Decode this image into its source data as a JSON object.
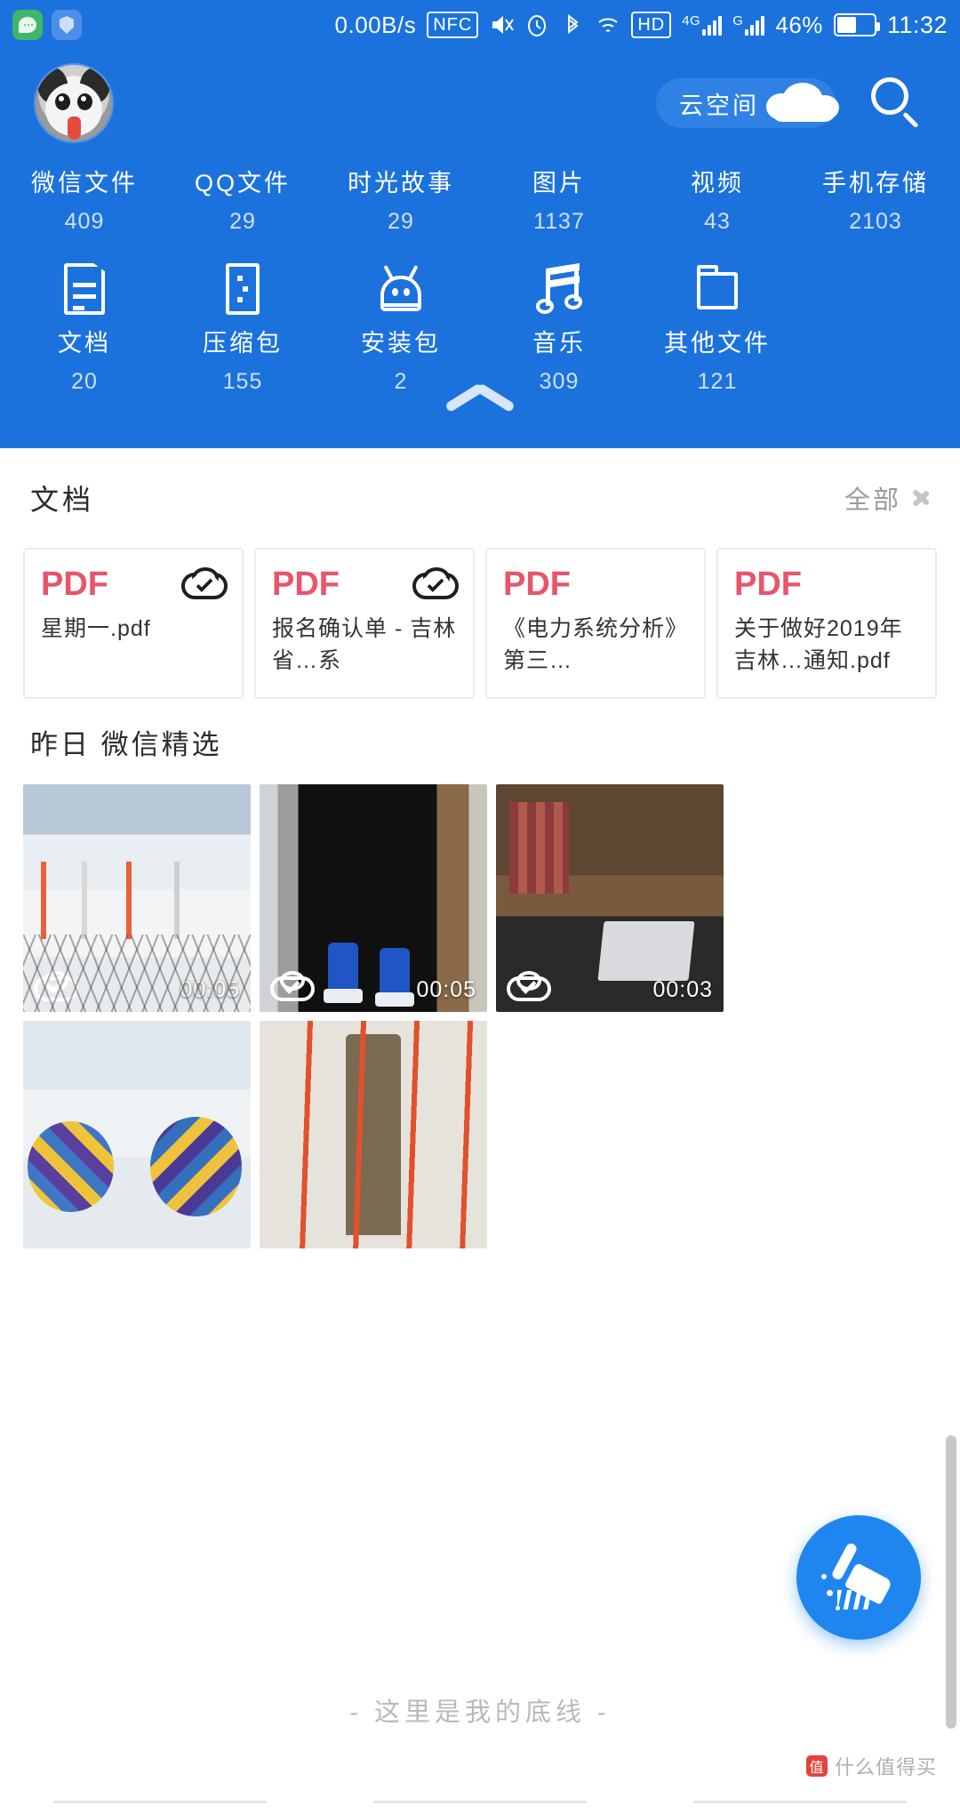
{
  "status_bar": {
    "network_speed": "0.00B/s",
    "nfc_label": "NFC",
    "hd_label": "HD",
    "sim1_label": "4G",
    "sim2_label": "G",
    "battery_percent": "46%",
    "time": "11:32",
    "icons": [
      "chat-app-icon",
      "shield-app-icon",
      "mute-icon",
      "alarm-icon",
      "bluetooth-icon",
      "wifi-icon"
    ]
  },
  "header": {
    "avatar_name": "user-avatar",
    "cloud_button_label": "云空间",
    "search_label": "search-icon",
    "collapse_label": "collapse-header",
    "categories_row1": [
      {
        "label": "微信文件",
        "count": "409"
      },
      {
        "label": "QQ文件",
        "count": "29"
      },
      {
        "label": "时光故事",
        "count": "29"
      },
      {
        "label": "图片",
        "count": "1137"
      },
      {
        "label": "视频",
        "count": "43"
      },
      {
        "label": "手机存储",
        "count": "2103"
      }
    ],
    "categories_row2": [
      {
        "label": "文档",
        "count": "20",
        "icon": "document-icon"
      },
      {
        "label": "压缩包",
        "count": "155",
        "icon": "zip-icon"
      },
      {
        "label": "安装包",
        "count": "2",
        "icon": "android-apk-icon"
      },
      {
        "label": "音乐",
        "count": "309",
        "icon": "music-note-icon"
      },
      {
        "label": "其他文件",
        "count": "121",
        "icon": "folder-icon"
      }
    ]
  },
  "documents_section": {
    "title": "文档",
    "more_label": "全部",
    "cards": [
      {
        "type": "PDF",
        "name": "星期一.pdf",
        "cloud": "cloud-synced-icon"
      },
      {
        "type": "PDF",
        "name": "报名确认单 - 吉林省…系",
        "cloud": "cloud-synced-icon"
      },
      {
        "type": "PDF",
        "name": "《电力系统分析》第三…",
        "cloud": ""
      },
      {
        "type": "PDF",
        "name": "关于做好2019年吉林…通知.pdf",
        "cloud": ""
      }
    ]
  },
  "media_section": {
    "title": "昨日 微信精选",
    "items": [
      {
        "duration": "00:05",
        "cloud": "cloud-synced-icon",
        "scene": "ski-resort-snow"
      },
      {
        "duration": "00:05",
        "cloud": "cloud-synced-icon",
        "scene": "ski-slope-boots"
      },
      {
        "duration": "00:03",
        "cloud": "cloud-synced-icon",
        "scene": "office-laptop"
      },
      {
        "duration": "",
        "cloud": "",
        "scene": "snow-tubes"
      },
      {
        "duration": "",
        "cloud": "",
        "scene": "snow-ramp-person"
      }
    ]
  },
  "footer": {
    "bottom_text": "- 这里是我的底线 -",
    "clean_button": "clean-broom-button",
    "watermark": "什么值得买"
  },
  "colors": {
    "brand_blue": "#1b72dd",
    "pdf_red": "#e8556b",
    "fab_blue": "#1f86f0"
  }
}
